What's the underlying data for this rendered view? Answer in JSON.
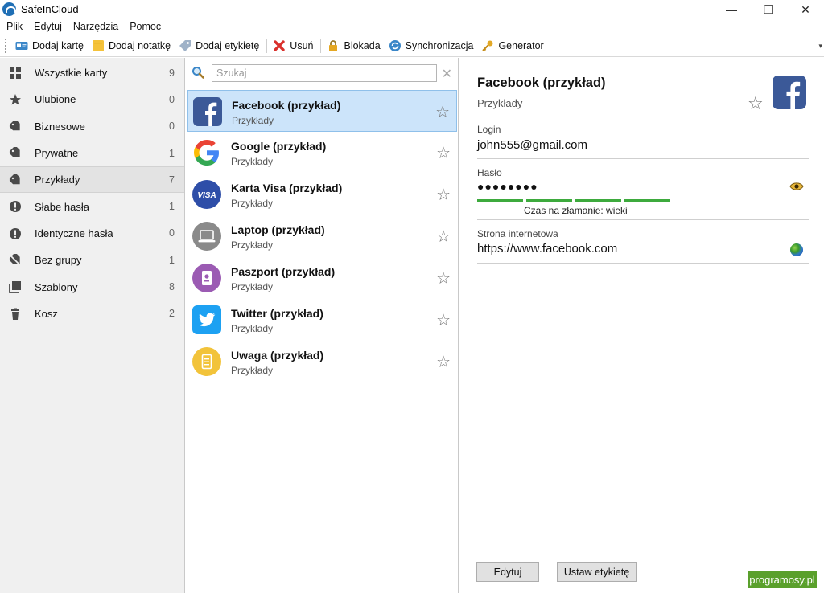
{
  "window": {
    "title": "SafeInCloud",
    "minimize": "—",
    "maximize": "❐",
    "close": "✕"
  },
  "menu": [
    "Plik",
    "Edytuj",
    "Narzędzia",
    "Pomoc"
  ],
  "toolbar": {
    "add_card": "Dodaj kartę",
    "add_note": "Dodaj notatkę",
    "add_label": "Dodaj etykietę",
    "delete": "Usuń",
    "lock": "Blokada",
    "sync": "Synchronizacja",
    "generator": "Generator"
  },
  "sidebar": {
    "items": [
      {
        "label": "Wszystkie karty",
        "count": "9",
        "icon": "grid-icon"
      },
      {
        "label": "Ulubione",
        "count": "0",
        "icon": "star-icon"
      },
      {
        "label": "Biznesowe",
        "count": "0",
        "icon": "tag-icon"
      },
      {
        "label": "Prywatne",
        "count": "1",
        "icon": "tag-icon"
      },
      {
        "label": "Przykłady",
        "count": "7",
        "icon": "tag-icon",
        "active": true
      },
      {
        "label": "Słabe hasła",
        "count": "1",
        "icon": "warning-icon"
      },
      {
        "label": "Identyczne hasła",
        "count": "0",
        "icon": "warning-icon"
      },
      {
        "label": "Bez grupy",
        "count": "1",
        "icon": "untagged-icon"
      },
      {
        "label": "Szablony",
        "count": "8",
        "icon": "templates-icon"
      },
      {
        "label": "Kosz",
        "count": "2",
        "icon": "trash-icon"
      }
    ]
  },
  "search": {
    "placeholder": "Szukaj",
    "value": ""
  },
  "cards": [
    {
      "title": "Facebook (przykład)",
      "subtitle": "Przykłady",
      "icon": "facebook-icon",
      "selected": true
    },
    {
      "title": "Google (przykład)",
      "subtitle": "Przykłady",
      "icon": "google-icon"
    },
    {
      "title": "Karta Visa (przykład)",
      "subtitle": "Przykłady",
      "icon": "visa-icon",
      "logo_text": "VISA"
    },
    {
      "title": "Laptop (przykład)",
      "subtitle": "Przykłady",
      "icon": "laptop-icon"
    },
    {
      "title": "Paszport (przykład)",
      "subtitle": "Przykłady",
      "icon": "passport-icon"
    },
    {
      "title": "Twitter (przykład)",
      "subtitle": "Przykłady",
      "icon": "twitter-icon"
    },
    {
      "title": "Uwaga (przykład)",
      "subtitle": "Przykłady",
      "icon": "note-icon"
    }
  ],
  "detail": {
    "title": "Facebook (przykład)",
    "subtitle": "Przykłady",
    "login_label": "Login",
    "login_value": "john555@gmail.com",
    "password_label": "Hasło",
    "password_value": "●●●●●●●●",
    "crack_time": "Czas na złamanie: wieki",
    "strength_segments": 4,
    "website_label": "Strona internetowa",
    "website_value": "https://www.facebook.com",
    "edit_button": "Edytuj",
    "set_label_button": "Ustaw etykietę"
  },
  "watermark": "programosy.pl",
  "colors": {
    "accent": "#1f6fb5",
    "selection": "#cce4fa",
    "strength": "#3daa3d"
  }
}
